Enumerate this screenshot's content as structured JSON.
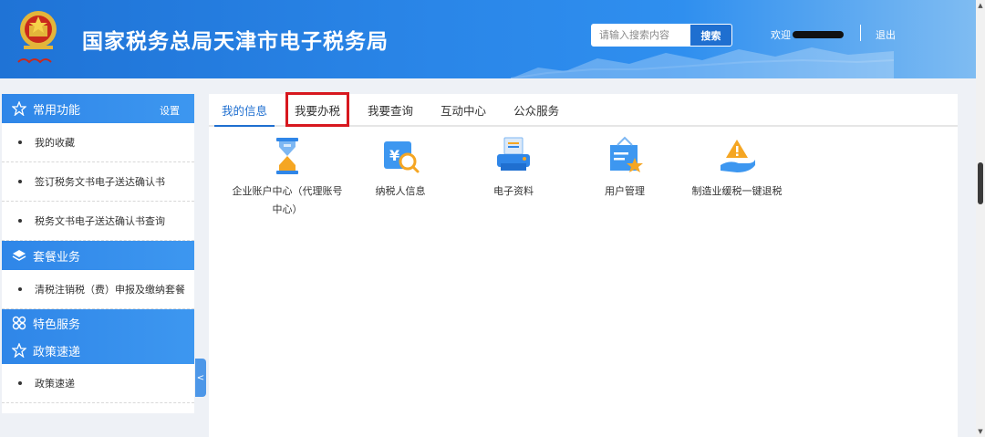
{
  "header": {
    "title": "国家税务总局天津市电子税务局",
    "search": {
      "placeholder": "请输入搜索内容",
      "button": "搜索"
    },
    "welcome": "欢迎",
    "logout": "退出"
  },
  "sidebar": {
    "sections": [
      {
        "title": "常用功能",
        "setting": "设置",
        "icon": "star-icon",
        "items": [
          "我的收藏",
          "签订税务文书电子送达确认书",
          "税务文书电子送达确认书查询"
        ]
      },
      {
        "title": "套餐业务",
        "icon": "layers-icon",
        "items": [
          "清税注销税（费）申报及缴纳套餐"
        ]
      },
      {
        "title": "特色服务",
        "icon": "grid-icon",
        "items": []
      },
      {
        "title": "政策速递",
        "icon": "star-icon",
        "items": [
          "政策速递"
        ]
      }
    ],
    "collapse": "<"
  },
  "tabs": [
    {
      "label": "我的信息",
      "active": true
    },
    {
      "label": "我要办税",
      "highlighted": true
    },
    {
      "label": "我要查询"
    },
    {
      "label": "互动中心"
    },
    {
      "label": "公众服务"
    }
  ],
  "apps": [
    {
      "label": "企业账户中心（代理账号中心）",
      "icon": "hourglass-icon"
    },
    {
      "label": "纳税人信息",
      "icon": "yuan-search-icon"
    },
    {
      "label": "电子资料",
      "icon": "printer-icon"
    },
    {
      "label": "用户管理",
      "icon": "user-star-icon"
    },
    {
      "label": "制造业缓税一键退税",
      "icon": "hand-warning-icon"
    }
  ],
  "colors": {
    "primary": "#1f6fd0",
    "header_start": "#1f73d6",
    "highlight_box": "#d7181f",
    "icon_blue": "#2f86e8",
    "icon_orange": "#f5a623"
  }
}
